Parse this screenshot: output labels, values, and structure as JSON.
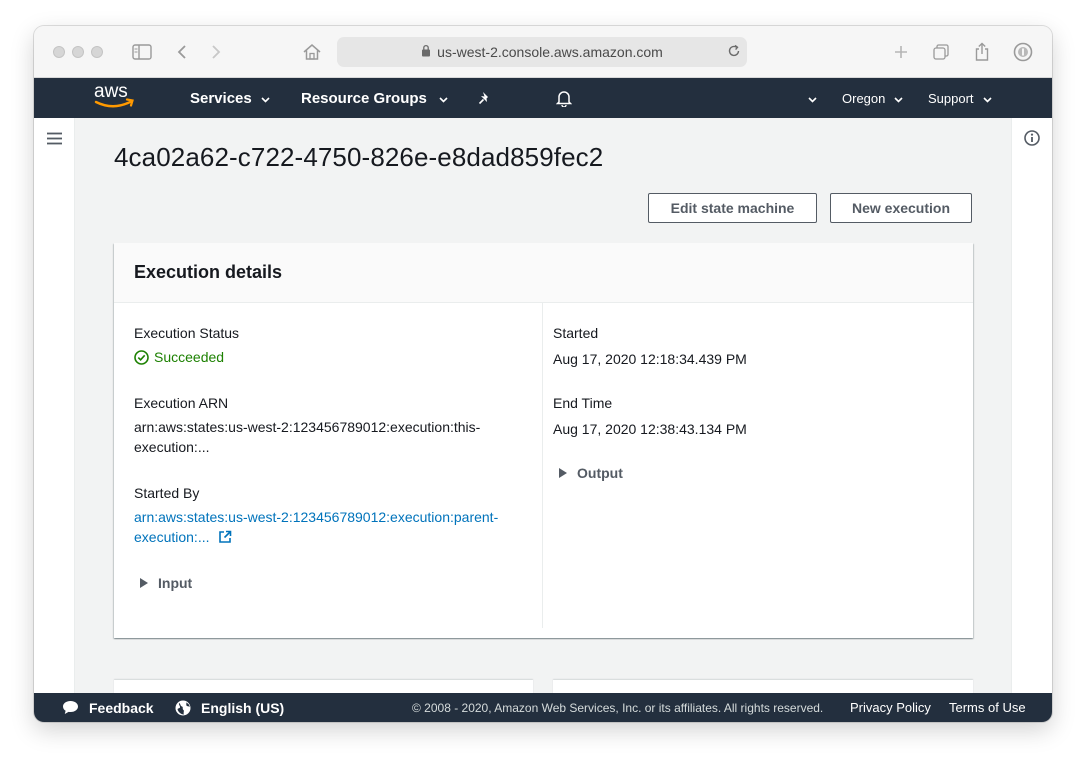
{
  "browser": {
    "url": "us-west-2.console.aws.amazon.com"
  },
  "nav": {
    "logo_text": "aws",
    "services": "Services",
    "resource_groups": "Resource Groups",
    "region": "Oregon",
    "support": "Support"
  },
  "page": {
    "title": "4ca02a62-c722-4750-826e-e8dad859fec2",
    "buttons": {
      "edit": "Edit state machine",
      "new_execution": "New execution"
    }
  },
  "details": {
    "heading": "Execution details",
    "status_label": "Execution Status",
    "status_value": "Succeeded",
    "arn_label": "Execution ARN",
    "arn_line1": "arn:aws:states:us-west-2:123456789012:execution:this-",
    "arn_line2": "execution:...",
    "started_by_label": "Started By",
    "started_by_line1": "arn:aws:states:us-west-2:123456789012:execution:parent-",
    "started_by_line2": "execution:...",
    "input_label": "Input",
    "started_label": "Started",
    "started_value": "Aug 17, 2020 12:18:34.439 PM",
    "end_label": "End Time",
    "end_value": "Aug 17, 2020 12:38:43.134 PM",
    "output_label": "Output"
  },
  "footer": {
    "feedback": "Feedback",
    "language": "English (US)",
    "copyright": "© 2008 - 2020, Amazon Web Services, Inc. or its affiliates. All rights reserved.",
    "privacy": "Privacy Policy",
    "terms": "Terms of Use"
  },
  "colors": {
    "nav_bg": "#232f3e",
    "success": "#1d8102",
    "link": "#0073bb",
    "aws_orange": "#ff9900"
  }
}
